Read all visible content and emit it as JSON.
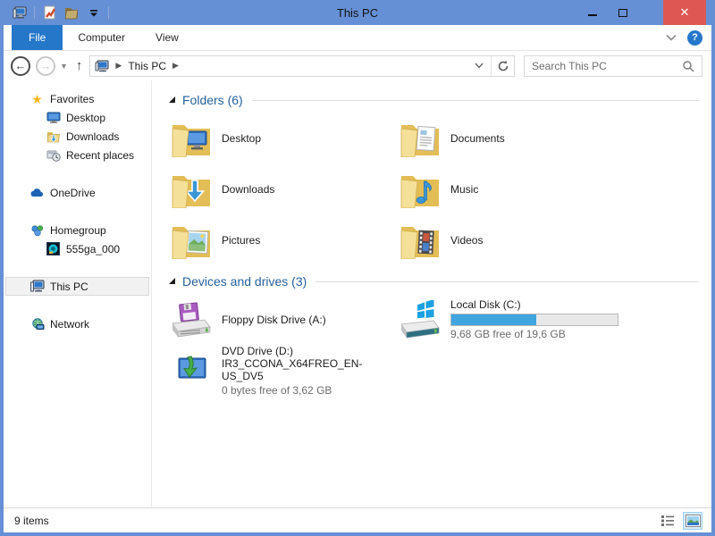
{
  "window": {
    "title": "This PC"
  },
  "titlebar": {
    "qat_icons": [
      "computer-icon",
      "properties-icon",
      "new-folder-icon",
      "customize-quick-access-icon"
    ]
  },
  "ribbon": {
    "tabs": [
      {
        "label": "File",
        "active": true
      },
      {
        "label": "Computer",
        "active": false
      },
      {
        "label": "View",
        "active": false
      }
    ]
  },
  "navbar": {
    "breadcrumb": {
      "root": "This PC"
    },
    "search_placeholder": "Search This PC"
  },
  "sidebar": {
    "items": [
      {
        "label": "Favorites",
        "icon": "star-icon"
      },
      {
        "label": "Desktop",
        "icon": "monitor-icon"
      },
      {
        "label": "Downloads",
        "icon": "folder-download-icon"
      },
      {
        "label": "Recent places",
        "icon": "recent-places-icon"
      },
      {
        "label": "OneDrive",
        "icon": "cloud-icon"
      },
      {
        "label": "Homegroup",
        "icon": "homegroup-icon"
      },
      {
        "label": "555ga_000",
        "icon": "user-avatar-icon"
      },
      {
        "label": "This PC",
        "icon": "computer-icon"
      },
      {
        "label": "Network",
        "icon": "network-icon"
      }
    ]
  },
  "content": {
    "groups": [
      {
        "title": "Folders",
        "count": "(6)",
        "items": [
          {
            "label": "Desktop",
            "icon": "folder-desktop-icon"
          },
          {
            "label": "Documents",
            "icon": "folder-documents-icon"
          },
          {
            "label": "Downloads",
            "icon": "folder-downloads-icon"
          },
          {
            "label": "Music",
            "icon": "folder-music-icon"
          },
          {
            "label": "Pictures",
            "icon": "folder-pictures-icon"
          },
          {
            "label": "Videos",
            "icon": "folder-videos-icon"
          }
        ]
      },
      {
        "title": "Devices and drives",
        "count": "(3)",
        "items": [
          {
            "label": "Floppy Disk Drive (A:)",
            "icon": "floppy-drive-icon"
          },
          {
            "label": "Local Disk (C:)",
            "icon": "hard-drive-icon",
            "free_text": "9,68 GB free of 19,6 GB",
            "used_percent": 51
          },
          {
            "label": "DVD Drive (D:)",
            "label2": "IR3_CCONA_X64FREO_EN-US_DV5",
            "icon": "dvd-drive-icon",
            "free_text": "0 bytes free of 3,62 GB"
          }
        ]
      }
    ]
  },
  "statusbar": {
    "items_count": "9 items",
    "view_icons": [
      "details-view-icon",
      "large-icons-view-icon"
    ]
  },
  "colors": {
    "titlebar": "#6690d6",
    "active_tab": "#2577ca",
    "close_button": "#dd5853",
    "group_header_text": "#26619c",
    "progress_fill": "#41a5e0"
  }
}
